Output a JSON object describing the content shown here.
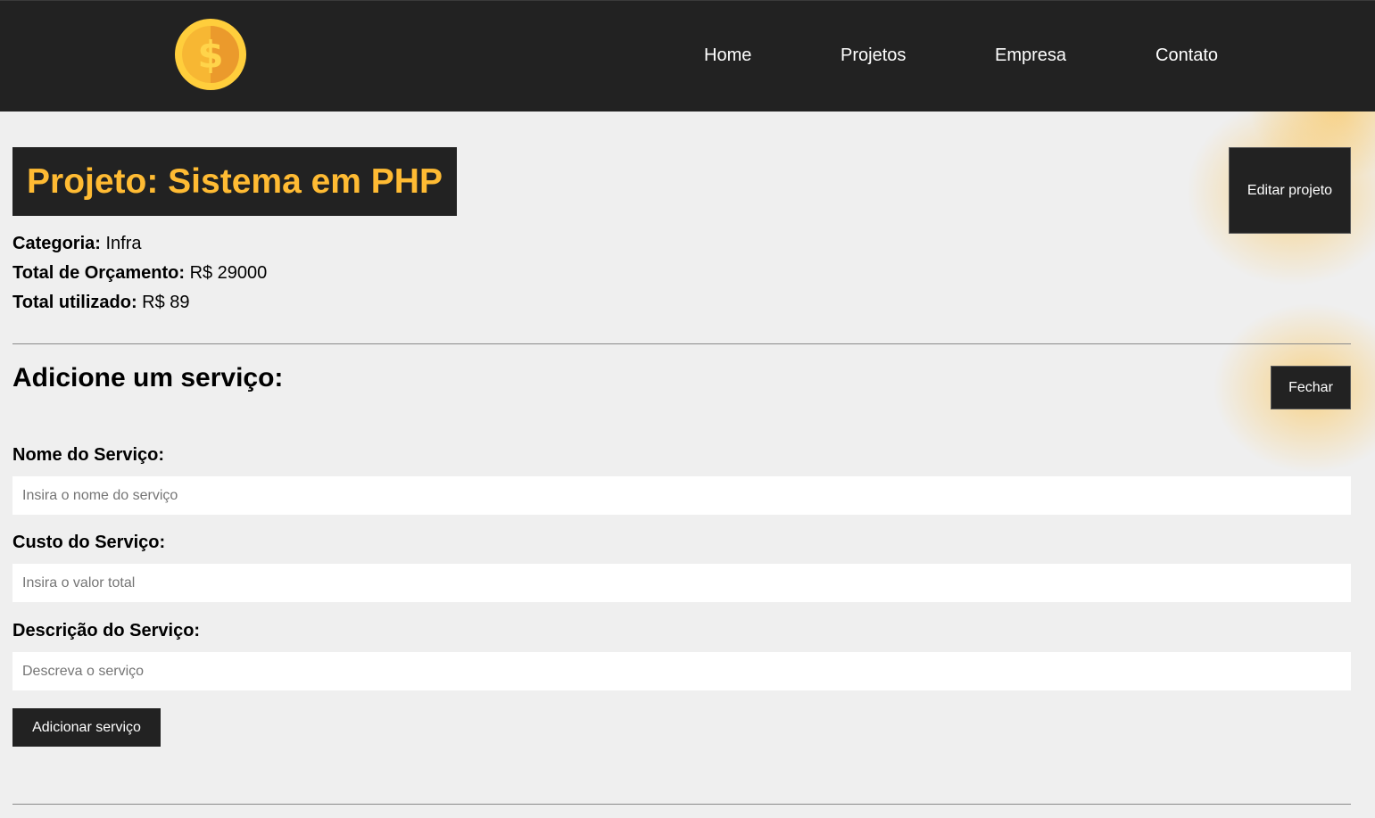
{
  "nav": {
    "links": [
      {
        "label": "Home"
      },
      {
        "label": "Projetos"
      },
      {
        "label": "Empresa"
      },
      {
        "label": "Contato"
      }
    ]
  },
  "project": {
    "title": "Projeto: Sistema em PHP",
    "edit_label": "Editar projeto",
    "category_label": "Categoria:",
    "category_value": "Infra",
    "budget_label": "Total de Orçamento:",
    "budget_value": "R$ 29000",
    "used_label": "Total utilizado:",
    "used_value": "R$ 89"
  },
  "service_form": {
    "heading": "Adicione um serviço:",
    "close_label": "Fechar",
    "name_label": "Nome do Serviço:",
    "name_placeholder": "Insira o nome do serviço",
    "cost_label": "Custo do Serviço:",
    "cost_placeholder": "Insira o valor total",
    "description_label": "Descrição do Serviço:",
    "description_placeholder": "Descreva o serviço",
    "submit_label": "Adicionar serviço"
  },
  "colors": {
    "navbar": "#222222",
    "accent": "#ffbb33",
    "background": "#efefef"
  },
  "icons": {
    "logo": "dollar-coin-icon"
  }
}
